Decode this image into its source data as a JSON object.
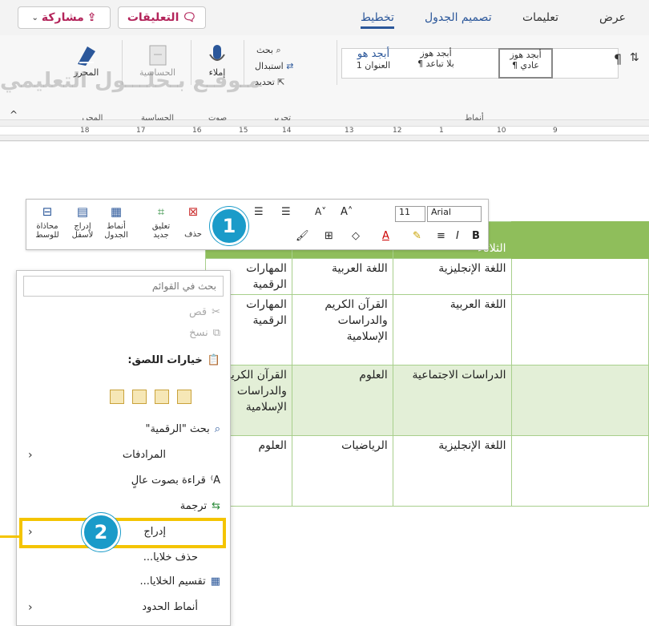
{
  "tabs": {
    "share": "مشاركة",
    "comments": "التعليقات",
    "layout": "تخطيط",
    "table_design": "تصميم الجدول",
    "help": "تعليمات",
    "view": "عرض"
  },
  "ribbon": {
    "editor_group": "المحرر",
    "editor_btn": "المحرر",
    "sensitivity_group": "الحساسية",
    "sensitivity_btn": "الحساسية",
    "voice_group": "صوت",
    "dictate_btn": "إملاء",
    "editing_group": "تحرير",
    "find": "بحث",
    "replace": "استبدال",
    "select": "تحديد",
    "styles_group": "أنماط",
    "style_normal": "¶ عادي",
    "style_no_spacing": "¶ بلا تباعد",
    "style_heading1": "العنوان 1",
    "style_sample1": "أبجد هوز",
    "style_sample2": "أبجد هوز",
    "style_sample3": "أبجد هو"
  },
  "ruler": [
    "18",
    "17",
    "16",
    "15",
    "14",
    "13",
    "12",
    "1",
    "10",
    "9"
  ],
  "watermark": "مـوقـع بـحلـــول التعليمي",
  "mini_toolbar": {
    "font_name": "Arial",
    "font_size": "11",
    "align_center": "محاذاة للوسط",
    "insert_below": "إدراج لأسفل",
    "table_styles": "أنماط الجدول",
    "new_comment": "تعليق جديد",
    "delete": "حذف"
  },
  "table": {
    "header": [
      "الثلاثاء",
      "",
      ""
    ],
    "rows": [
      [
        "اللغة الإنجليزية",
        "اللغة العربية",
        "المهارات الرقمية"
      ],
      [
        "اللغة العربية",
        "القرآن الكريم والدراسات الإسلامية",
        "المهارات الرقمية"
      ],
      [
        "الدراسات الاجتماعية",
        "العلوم",
        "القرآن الكريم والدراسات الإسلامية"
      ],
      [
        "اللغة الإنجليزية",
        "الرياضيات",
        "العلوم"
      ]
    ]
  },
  "context_menu": {
    "search_placeholder": "بحث في القوائم",
    "cut": "قص",
    "copy": "نسخ",
    "paste_options": "خيارات اللصق:",
    "search_term": "بحث \"الرقمية\"",
    "synonyms": "المرادفات",
    "read_aloud": "قراءة بصوت عالٍ",
    "translate": "ترجمة",
    "insert": "إدراج",
    "delete_cells": "حذف خلايا...",
    "split_cells": "تقسيم الخلايا...",
    "border_styles": "أنماط الحدود"
  },
  "callouts": {
    "one": "1",
    "two": "2"
  },
  "colors": {
    "accent": "#2b579a",
    "brand": "#b3245a",
    "highlight": "#f4c400",
    "callout": "#1a9bc9",
    "table_header": "#8fbe5b"
  }
}
